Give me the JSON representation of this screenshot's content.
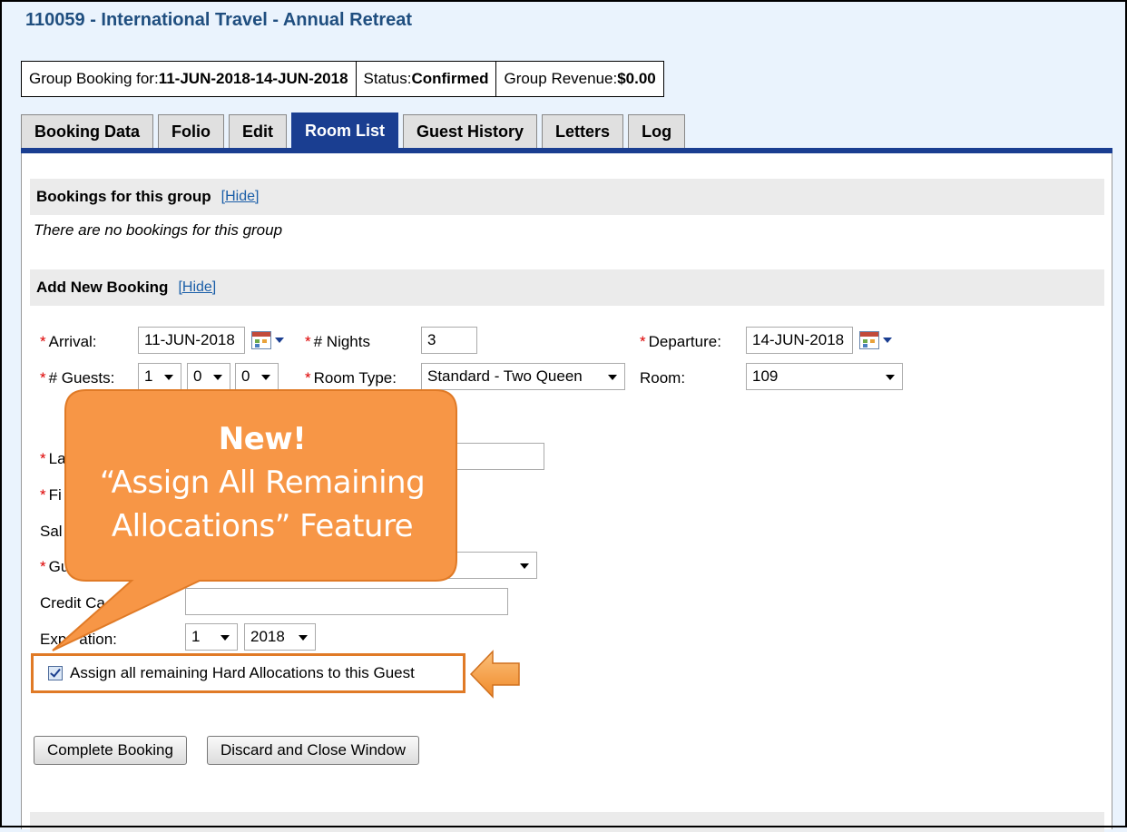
{
  "page_title": "110059 - International Travel - Annual Retreat",
  "info_bar": {
    "booking_label": "Group Booking for:",
    "booking_value": "11-JUN-2018-14-JUN-2018",
    "status_label": "Status:",
    "status_value": "Confirmed",
    "revenue_label": "Group Revenue:",
    "revenue_value": "$0.00"
  },
  "tabs": [
    {
      "label": "Booking Data",
      "active": false
    },
    {
      "label": "Folio",
      "active": false
    },
    {
      "label": "Edit",
      "active": false
    },
    {
      "label": "Room List",
      "active": true
    },
    {
      "label": "Guest History",
      "active": false
    },
    {
      "label": "Letters",
      "active": false
    },
    {
      "label": "Log",
      "active": false
    }
  ],
  "bookings_section": {
    "title": "Bookings for this group",
    "hide_link": "[Hide]",
    "empty_message": "There are no bookings for this group"
  },
  "add_section": {
    "title": "Add New Booking",
    "hide_link": "[Hide]"
  },
  "form": {
    "required_mark": "*",
    "arrival_label": "Arrival:",
    "arrival_value": "11-JUN-2018",
    "nights_label": "# Nights",
    "nights_value": "3",
    "departure_label": "Departure:",
    "departure_value": "14-JUN-2018",
    "guests_label": "# Guests:",
    "guests_adults": "1",
    "guests_children": "0",
    "guests_infants": "0",
    "room_type_label": "Room Type:",
    "room_type_value": "Standard - Two Queen",
    "room_label": "Room:",
    "room_value": "109",
    "last_name_label_partial": "La",
    "first_name_label_partial": "Fi",
    "salutation_label_partial": "Sal",
    "guest_type_label_partial": "Gu",
    "credit_card_label_partial": "Credit Ca",
    "expiration_label_start": "Exp",
    "expiration_label_end": "ation:",
    "exp_month": "1",
    "exp_year": "2018",
    "assign_label": "Assign all remaining Hard Allocations to this Guest"
  },
  "buttons": {
    "complete": "Complete Booking",
    "discard": "Discard and Close Window"
  },
  "callout": {
    "headline": "New!",
    "line1": "“Assign All Remaining",
    "line2": "Allocations” Feature",
    "fill_color": "#f79646",
    "border_color": "#e07a26"
  },
  "colors": {
    "title": "#1f4e7f",
    "tab_active": "#1a3e91",
    "link": "#1a5ea8",
    "required": "#dd0000"
  }
}
